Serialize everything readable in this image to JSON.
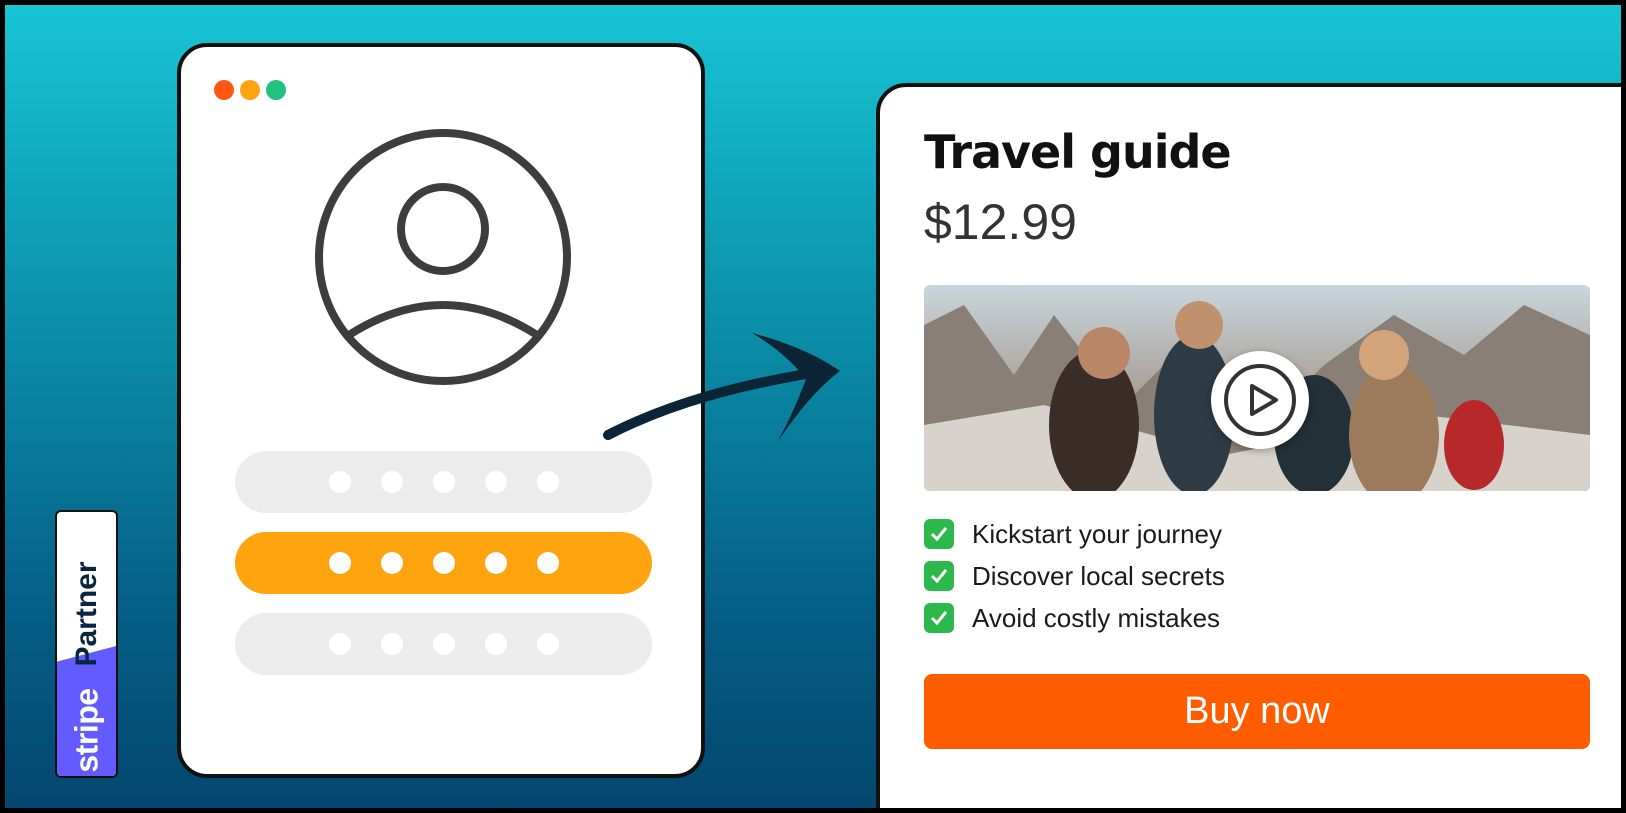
{
  "login_window": {
    "window_dot_colors": [
      "#ff5a14",
      "#ffa40f",
      "#1fc27f"
    ],
    "field_colors": {
      "default": "#ececec",
      "active": "#ffa40f"
    },
    "password_dot_count": 5
  },
  "stripe_badge": {
    "partner_label": "Partner",
    "brand_label": "stripe",
    "brand_color": "#635bff"
  },
  "product": {
    "title": "Travel guide",
    "price": "$12.99",
    "features": [
      "Kickstart your journey",
      "Discover local secrets",
      "Avoid costly mistakes"
    ],
    "buy_label": "Buy now",
    "accent_color": "#ff5c00"
  }
}
